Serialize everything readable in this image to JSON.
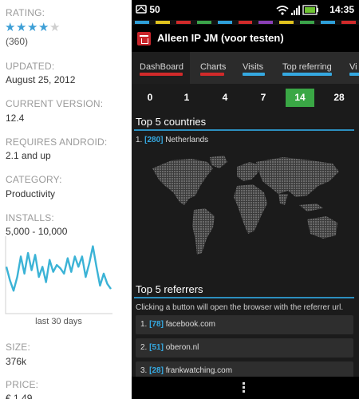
{
  "details": {
    "rating_label": "RATING:",
    "rating_stars_filled": 4,
    "rating_stars_total": 5,
    "rating_count": "(360)",
    "updated_label": "UPDATED:",
    "updated_value": "August 25, 2012",
    "version_label": "CURRENT VERSION:",
    "version_value": "12.4",
    "android_label": "REQUIRES ANDROID:",
    "android_value": "2.1 and up",
    "category_label": "CATEGORY:",
    "category_value": "Productivity",
    "installs_label": "INSTALLS:",
    "installs_value": "5,000 - 10,000",
    "trend_caption": "last 30 days",
    "trend_values": [
      26,
      18,
      12,
      20,
      32,
      22,
      34,
      24,
      33,
      20,
      26,
      17,
      30,
      23,
      27,
      25,
      22,
      31,
      23,
      32,
      26,
      32,
      20,
      28,
      38,
      26,
      15,
      22,
      16,
      13
    ],
    "size_label": "SIZE:",
    "size_value": "376k",
    "price_label": "PRICE:",
    "price_value": "€ 1.49",
    "colors": {
      "star": "#3d9fd6",
      "trend_line": "#3bb3d6"
    }
  },
  "phone": {
    "status": {
      "notification_count": "50",
      "time": "14:35"
    },
    "color_strip": [
      "#2e9fd8",
      "#e0c21e",
      "#d12a2a",
      "#3ba44a",
      "#2e9fd8",
      "#d12a2a",
      "#8a3fb5",
      "#e0c21e",
      "#3ba44a",
      "#2e9fd8",
      "#d12a2a"
    ],
    "app_title": "Alleen IP JM (voor testen)",
    "tabs": [
      {
        "label": "DashBoard",
        "color": "#d12a2a"
      },
      {
        "label": "Charts",
        "color": "#d12a2a"
      },
      {
        "label": "Visits",
        "color": "#35a8e0"
      },
      {
        "label": "Top referring",
        "color": "#35a8e0"
      },
      {
        "label": "Vi",
        "color": "#35a8e0"
      }
    ],
    "day_ranges": [
      "0",
      "1",
      "4",
      "7",
      "14",
      "28"
    ],
    "selected_day": "14",
    "countries_title": "Top 5 countries",
    "countries": [
      {
        "rank": "1.",
        "count": "[280]",
        "name": "Netherlands"
      }
    ],
    "referrers_title": "Top 5 referrers",
    "referrers_hint": "Clicking a button will open the browser with the referrer url.",
    "referrers": [
      {
        "rank": "1.",
        "count": "[78]",
        "site": "facebook.com"
      },
      {
        "rank": "2.",
        "count": "[51]",
        "site": "oberon.nl"
      },
      {
        "rank": "3.",
        "count": "[28]",
        "site": "frankwatching.com"
      }
    ]
  }
}
